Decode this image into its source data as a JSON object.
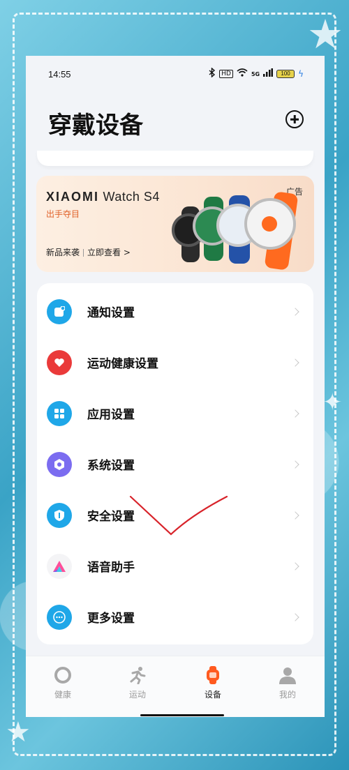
{
  "status_bar": {
    "time": "14:55",
    "hd_badge": "HD",
    "signal_label": "5G",
    "battery": "100"
  },
  "header": {
    "title": "穿戴设备"
  },
  "ad_banner": {
    "brand_logo": "XIAOMI",
    "brand_model": "Watch S4",
    "slogan": "出手夺目",
    "tag": "广告",
    "new_label": "新品来袭",
    "cta": "立即查看 >"
  },
  "settings": {
    "items": [
      {
        "label": "通知设置",
        "icon": "notification-icon",
        "color": "#1fa7e8"
      },
      {
        "label": "运动健康设置",
        "icon": "heart-icon",
        "color": "#ea3a3a"
      },
      {
        "label": "应用设置",
        "icon": "apps-grid-icon",
        "color": "#1fa7e8"
      },
      {
        "label": "系统设置",
        "icon": "system-hexagon-icon",
        "color": "#7b6cf0"
      },
      {
        "label": "安全设置",
        "icon": "shield-icon",
        "color": "#1fa7e8"
      },
      {
        "label": "语音助手",
        "icon": "voice-assistant-icon",
        "color": "#ff5aa0"
      },
      {
        "label": "更多设置",
        "icon": "more-dots-icon",
        "color": "#1fa7e8"
      }
    ]
  },
  "tab_bar": {
    "tabs": [
      {
        "label": "健康",
        "icon": "health-ring-icon",
        "active": false
      },
      {
        "label": "运动",
        "icon": "running-icon",
        "active": false
      },
      {
        "label": "设备",
        "icon": "watch-icon",
        "active": true
      },
      {
        "label": "我的",
        "icon": "profile-icon",
        "active": false
      }
    ]
  },
  "colors": {
    "accent": "#ff5a1f",
    "card_bg": "#ffffff",
    "page_bg": "#f2f4f8"
  }
}
